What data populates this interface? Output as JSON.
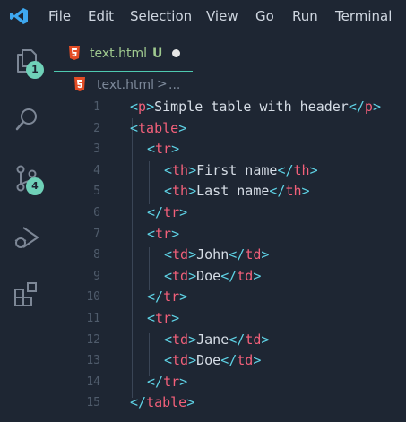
{
  "menu": [
    "File",
    "Edit",
    "Selection",
    "View",
    "Go",
    "Run",
    "Terminal"
  ],
  "activity": {
    "explorer_badge": "1",
    "scm_badge": "4"
  },
  "tab": {
    "filename": "text.html",
    "status": "U"
  },
  "breadcrumb": {
    "file": "text.html",
    "separator": ">",
    "more": "..."
  },
  "colors": {
    "background": "#1e2633",
    "bracket": "#5fd3e6",
    "tag": "#f2607a",
    "text": "#d6dde6",
    "badge": "#6fd1b8",
    "untracked": "#9fc98f"
  },
  "code_lines": [
    {
      "num": "1",
      "indent": 0,
      "open": "p",
      "text": "Simple table with header",
      "close": "p"
    },
    {
      "num": "2",
      "indent": 0,
      "open": "table",
      "text": "",
      "close": ""
    },
    {
      "num": "3",
      "indent": 1,
      "open": "tr",
      "text": "",
      "close": ""
    },
    {
      "num": "4",
      "indent": 2,
      "open": "th",
      "text": "First name",
      "close": "th"
    },
    {
      "num": "5",
      "indent": 2,
      "open": "th",
      "text": "Last name",
      "close": "th"
    },
    {
      "num": "6",
      "indent": 1,
      "open": "",
      "text": "",
      "close": "tr"
    },
    {
      "num": "7",
      "indent": 1,
      "open": "tr",
      "text": "",
      "close": ""
    },
    {
      "num": "8",
      "indent": 2,
      "open": "td",
      "text": "John",
      "close": "td"
    },
    {
      "num": "9",
      "indent": 2,
      "open": "td",
      "text": "Doe",
      "close": "td"
    },
    {
      "num": "10",
      "indent": 1,
      "open": "",
      "text": "",
      "close": "tr"
    },
    {
      "num": "11",
      "indent": 1,
      "open": "tr",
      "text": "",
      "close": ""
    },
    {
      "num": "12",
      "indent": 2,
      "open": "td",
      "text": "Jane",
      "close": "td"
    },
    {
      "num": "13",
      "indent": 2,
      "open": "td",
      "text": "Doe",
      "close": "td"
    },
    {
      "num": "14",
      "indent": 1,
      "open": "",
      "text": "",
      "close": "tr"
    },
    {
      "num": "15",
      "indent": 0,
      "open": "",
      "text": "",
      "close": "table"
    }
  ]
}
